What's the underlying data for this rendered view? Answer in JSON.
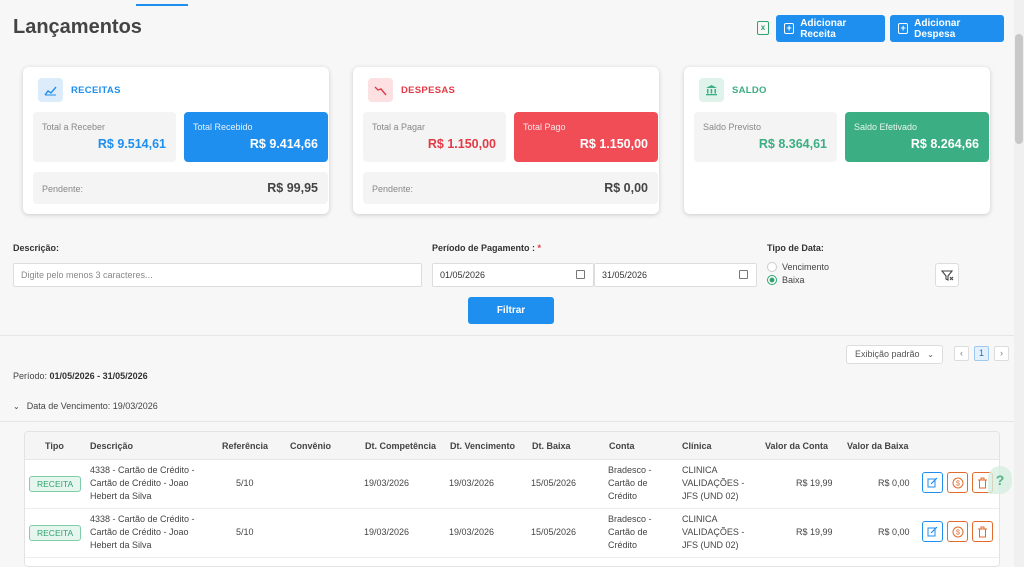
{
  "page": {
    "title": "Lançamentos"
  },
  "toolbar": {
    "export_icon": "excel-export-icon",
    "add_receita_label": "Adicionar Receita",
    "add_despesa_label": "Adicionar Despesa"
  },
  "cards": {
    "receitas": {
      "title": "RECEITAS",
      "icon": "trend-up-icon",
      "left_label": "Total a Receber",
      "left_value": "R$ 9.514,61",
      "right_label": "Total Recebido",
      "right_value": "R$ 9.414,66",
      "pending_label": "Pendente:",
      "pending_value": "R$ 99,95",
      "accent": "#1e8fef"
    },
    "despesas": {
      "title": "DESPESAS",
      "icon": "trend-down-icon",
      "left_label": "Total a Pagar",
      "left_value": "R$ 1.150,00",
      "right_label": "Total Pago",
      "right_value": "R$ 1.150,00",
      "pending_label": "Pendente:",
      "pending_value": "R$ 0,00",
      "accent": "#f04d57"
    },
    "saldo": {
      "title": "SALDO",
      "icon": "bank-icon",
      "left_label": "Saldo Previsto",
      "left_value": "R$ 8.364,61",
      "right_label": "Saldo Efetivado",
      "right_value": "R$ 8.264,66",
      "accent": "#3cae83"
    }
  },
  "filters": {
    "descricao_label": "Descrição:",
    "descricao_placeholder": "Digite pelo menos 3 caracteres...",
    "periodo_label": "Período de Pagamento :",
    "required_mark": "*",
    "date_start": "01/05/2026",
    "date_end": "31/05/2026",
    "tipo_data_label": "Tipo de Data:",
    "tipo_options": [
      "Vencimento",
      "Baixa"
    ],
    "tipo_selected": "Baixa",
    "filter_button": "Filtrar"
  },
  "results": {
    "view_select": "Exibição padrão",
    "current_page": "1",
    "periodo_label": "Período:",
    "periodo_value": "01/05/2026 - 31/05/2026",
    "group_label": "Data de Vencimento: 19/03/2026"
  },
  "table": {
    "columns": [
      "Tipo",
      "Descrição",
      "Referência",
      "Convênio",
      "Dt. Competência",
      "Dt. Vencimento",
      "Dt. Baixa",
      "Conta",
      "Clínica",
      "Valor da Conta",
      "Valor da Baixa"
    ],
    "rows": [
      {
        "tipo": "RECEITA",
        "descricao": [
          "4338 - Cartão de Crédito -",
          "Cartão de Crédito - Joao",
          "Hebert da Silva"
        ],
        "referencia": "5/10",
        "convenio": "",
        "dt_competencia": "19/03/2026",
        "dt_vencimento": "19/03/2026",
        "dt_baixa": "15/05/2026",
        "conta": [
          "Bradesco -",
          "Cartão de",
          "Crédito"
        ],
        "clinica": [
          "CLINICA",
          "VALIDAÇÕES -",
          "JFS (UND 02)"
        ],
        "valor_conta": "R$ 19,99",
        "valor_baixa": "R$ 0,00"
      },
      {
        "tipo": "RECEITA",
        "descricao": [
          "4338 - Cartão de Crédito -",
          "Cartão de Crédito - Joao",
          "Hebert da Silva"
        ],
        "referencia": "5/10",
        "convenio": "",
        "dt_competencia": "19/03/2026",
        "dt_vencimento": "19/03/2026",
        "dt_baixa": "15/05/2026",
        "conta": [
          "Bradesco -",
          "Cartão de",
          "Crédito"
        ],
        "clinica": [
          "CLINICA",
          "VALIDAÇÕES -",
          "JFS (UND 02)"
        ],
        "valor_conta": "R$ 19,99",
        "valor_baixa": "R$ 0,00"
      }
    ]
  },
  "colors": {
    "primary": "#1e8fef",
    "danger": "#f04d57",
    "success": "#3cae83"
  }
}
